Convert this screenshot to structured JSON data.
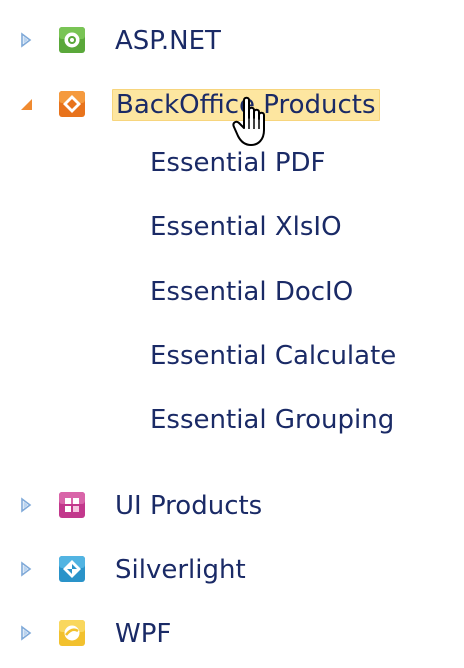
{
  "tree": {
    "nodes": [
      {
        "label": "ASP.NET",
        "expanded": false,
        "icon": "aspnet-icon",
        "icon_color": "#5aa83a"
      },
      {
        "label": "BackOffice Products",
        "expanded": true,
        "selected": true,
        "icon": "backoffice-icon",
        "icon_color": "#e8731c",
        "children": [
          {
            "label": "Essential PDF"
          },
          {
            "label": "Essential XlsIO"
          },
          {
            "label": "Essential DocIO"
          },
          {
            "label": "Essential Calculate"
          },
          {
            "label": "Essential Grouping"
          }
        ]
      },
      {
        "label": "UI Products",
        "expanded": false,
        "icon": "ui-products-icon",
        "icon_color": "#c2388c"
      },
      {
        "label": "Silverlight",
        "expanded": false,
        "icon": "silverlight-icon",
        "icon_color": "#2a93c9"
      },
      {
        "label": "WPF",
        "expanded": false,
        "icon": "wpf-icon",
        "icon_color": "#f2c12e"
      }
    ]
  },
  "colors": {
    "text": "#1a2a66",
    "selection_bg": "#fde6a0",
    "expander_collapsed": "#7fa9d8",
    "expander_expanded": "#f08a30"
  }
}
